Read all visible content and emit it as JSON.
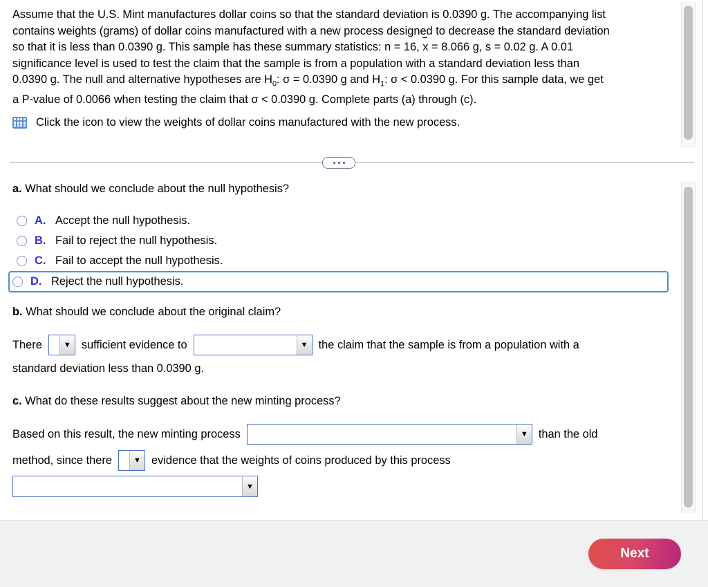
{
  "problem": {
    "line1": "Assume that the U.S. Mint manufactures dollar coins so that the standard deviation is 0.0390 g. The accompanying list",
    "line2": "contains weights (grams) of dollar coins manufactured with a new process designed to decrease the standard deviation",
    "line3_a": "so that it is less than 0.0390 g. This sample has these summary statistics: n = 16, ",
    "line3_xbar": "x",
    "line3_b": " = 8.066 g, s = 0.02 g. A 0.01",
    "line4": "significance level  is used to test the claim that the sample is from a population with a standard deviation less than",
    "line5_a": "0.0390 g. The null and alternative hypotheses are H",
    "line5_sub0": "0",
    "line5_b": ": σ = 0.0390 g and H",
    "line5_sub1": "1",
    "line5_c": ": σ < 0.0390 g. For this sample data, we get",
    "line6": "a P-value of 0.0066 when testing the claim that σ < 0.0390 g. Complete parts (a) through (c).",
    "icon_name": "table-grid-icon",
    "icon_link_text": "Click the icon to view the weights of dollar coins manufactured with the new process."
  },
  "divider": {
    "dots_label": "•••"
  },
  "part_a": {
    "question": "a. What should we conclude about the null hypothesis?",
    "question_prefix": "a.",
    "question_rest": " What should we conclude about the null hypothesis?",
    "choices": [
      {
        "letter": "A.",
        "text": "Accept the null hypothesis.",
        "selected": false
      },
      {
        "letter": "B.",
        "text": "Fail to reject the null hypothesis.",
        "selected": false
      },
      {
        "letter": "C.",
        "text": "Fail to accept the null hypothesis.",
        "selected": false
      },
      {
        "letter": "D.",
        "text": "Reject the null hypothesis.",
        "selected": true
      }
    ]
  },
  "part_b": {
    "question_prefix": "b.",
    "question_rest": " What should we conclude about the original claim?",
    "text_there": "There",
    "dropdown1_value": "",
    "text_sufficient": "sufficient evidence to",
    "dropdown2_value": "",
    "text_claim": "the claim that the sample is from a population with a",
    "line2": "standard deviation less than 0.0390 g."
  },
  "part_c": {
    "question_prefix": "c.",
    "question_rest": " What do these results suggest about the new minting process?",
    "text_based": "Based on this result, the new minting process",
    "dropdown1_value": "",
    "text_than_old": "than the old",
    "text_method_since": "method, since there",
    "dropdown2_value": "",
    "text_evidence": "evidence that the weights of coins produced by this process",
    "dropdown3_value": ""
  },
  "footer": {
    "next_label": "Next"
  },
  "colors": {
    "accent_blue": "#3333cc",
    "focus_border": "#4a90d4",
    "dropdown_border": "#4a6fc0",
    "icon_blue": "#5b8fd6",
    "next_gradient_start": "#e0504a",
    "next_gradient_end": "#b5267a",
    "footer_bg": "#f1f1f1"
  }
}
